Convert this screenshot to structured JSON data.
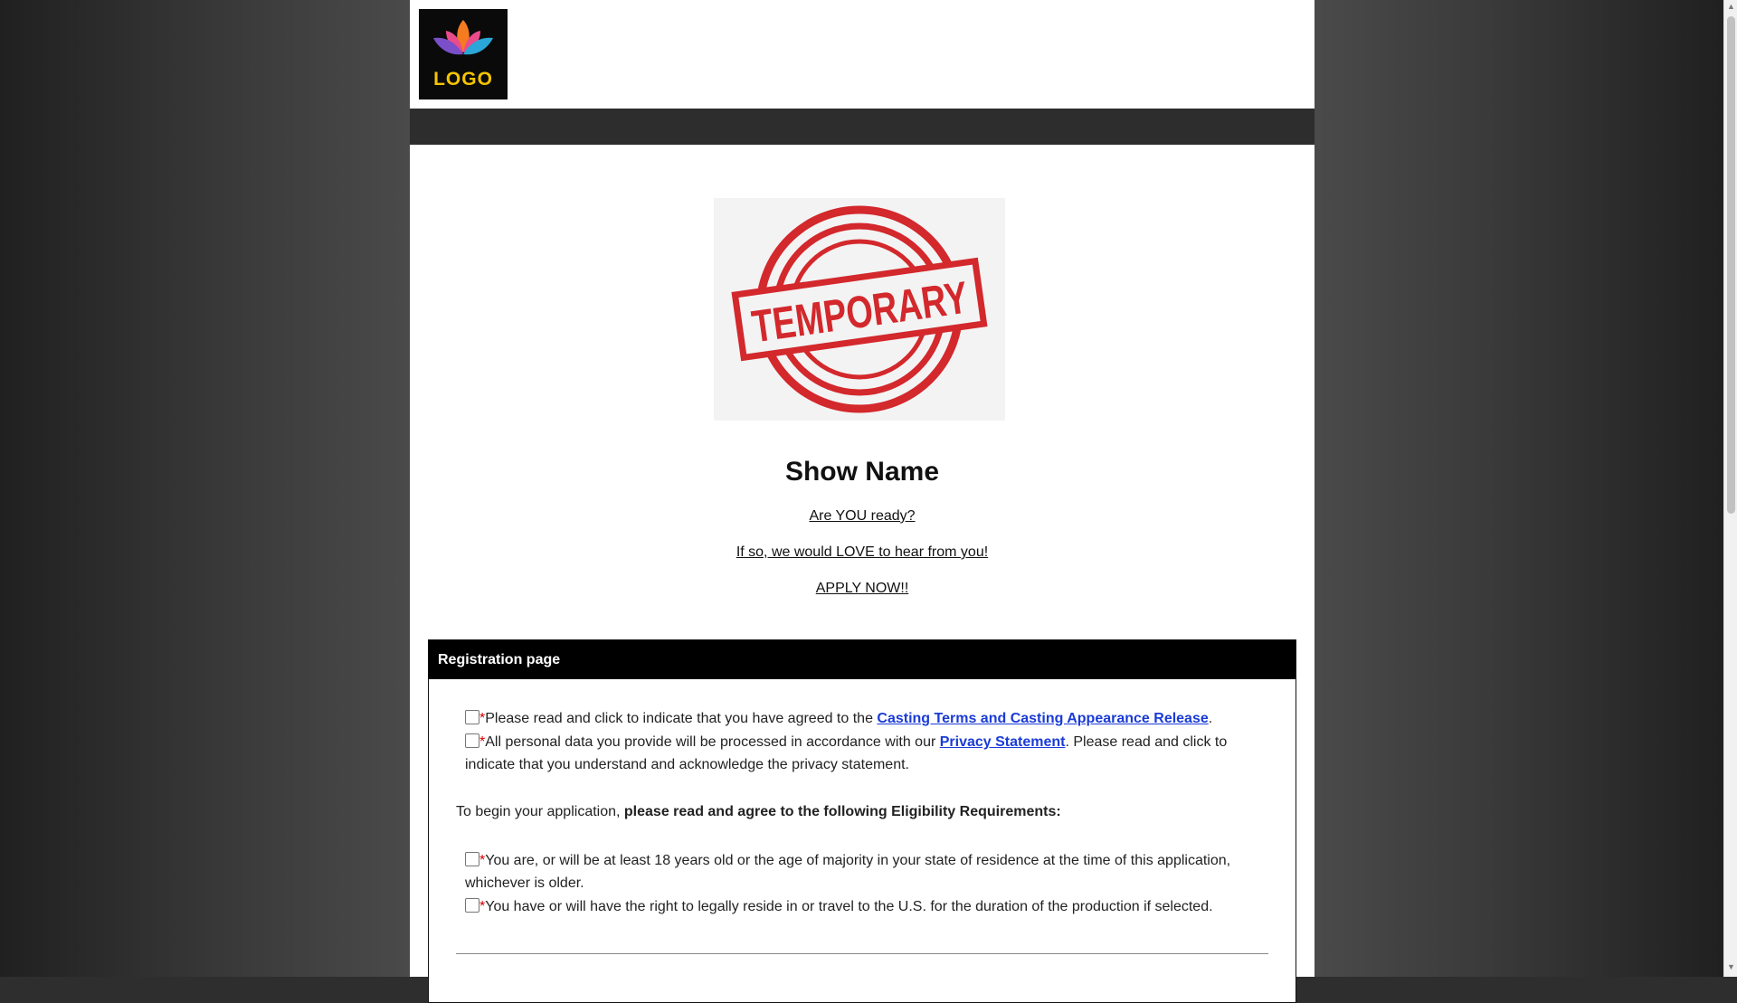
{
  "logo": {
    "text": "LOGO",
    "icon": "lotus-icon",
    "bg_color": "#0a0a0a"
  },
  "stamp": {
    "text": "TEMPORARY",
    "color": "#d3282c"
  },
  "hero": {
    "title": "Show Name",
    "line1": "Are YOU ready?",
    "line2": "If so, we would LOVE to hear from you!",
    "line3": "APPLY NOW!!"
  },
  "panel": {
    "title": "Registration page",
    "agree_terms": {
      "required_mark": "*",
      "text_before": "Please read and click to indicate that you have agreed to the ",
      "link_text": "Casting Terms and Casting Appearance Release",
      "text_after": "."
    },
    "privacy": {
      "required_mark": "*",
      "text_before": "All personal data you provide will be processed in accordance with our ",
      "link_text": "Privacy Statement",
      "text_after": ". Please read and click to",
      "text_line2": "indicate that you understand and acknowledge the privacy statement."
    },
    "eligibility_intro": "To begin your application, ",
    "eligibility_intro_bold": "please read and agree to the following Eligibility Requirements:",
    "req_age": {
      "required_mark": "*",
      "text": "You are, or will be at least 18 years old or the age of majority in your state of residence at the time of this application,",
      "text_line2": "whichever is older."
    },
    "req_residence": {
      "required_mark": "*",
      "text": "You have or will have the right to legally reside in or travel to the U.S. for the duration of the production if selected."
    }
  },
  "colors": {
    "link": "#1a3bd6",
    "required": "#d20000",
    "navbar": "#2d2d2d"
  }
}
